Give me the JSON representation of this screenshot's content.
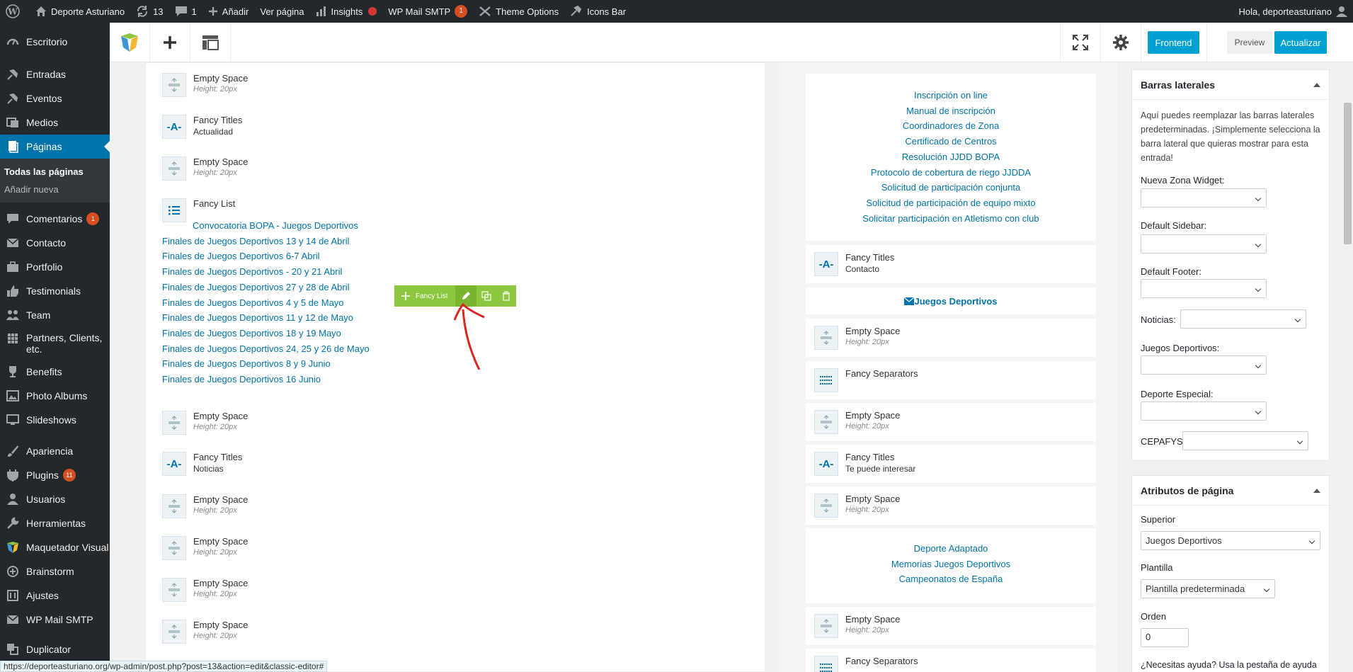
{
  "adminbar": {
    "site_name": "Deporte Asturiano",
    "updates_count": "13",
    "comments_count": "1",
    "add_new": "Añadir",
    "view_page": "Ver página",
    "insights": "Insights",
    "wp_mail_smtp": "WP Mail SMTP",
    "wp_mail_badge": "1",
    "theme_options": "Theme Options",
    "icons_bar": "Icons Bar",
    "greeting": "Hola, deporteasturiano"
  },
  "sidebar": {
    "escritorio": "Escritorio",
    "entradas": "Entradas",
    "eventos": "Eventos",
    "medios": "Medios",
    "paginas": "Páginas",
    "sub_todas": "Todas las páginas",
    "sub_nueva": "Añadir nueva",
    "comentarios": "Comentarios",
    "comentarios_badge": "1",
    "contacto": "Contacto",
    "portfolio": "Portfolio",
    "testimonials": "Testimonials",
    "team": "Team",
    "partners": "Partners, Clients, etc.",
    "benefits": "Benefits",
    "photo_albums": "Photo Albums",
    "slideshows": "Slideshows",
    "apariencia": "Apariencia",
    "plugins": "Plugins",
    "plugins_badge": "11",
    "usuarios": "Usuarios",
    "herramientas": "Herramientas",
    "maquetador": "Maquetador Visual",
    "brainstorm": "Brainstorm",
    "ajustes": "Ajustes",
    "wp_mail_smtp": "WP Mail SMTP",
    "duplicator": "Duplicator"
  },
  "vc_toolbar": {
    "frontend": "Frontend",
    "preview": "Preview",
    "update": "Actualizar"
  },
  "left_column": {
    "empty_space": "Empty Space",
    "height_20": "Height: 20px",
    "fancy_titles": "Fancy Titles",
    "fancy_list": "Fancy List",
    "title_actualidad": "Actualidad",
    "title_noticias": "Noticias",
    "list_links": [
      "Convocatoria BOPA - Juegos Deportivos",
      "Finales de Juegos Deportivos 13 y 14 de Abril",
      "Finales de Juegos Deportivos 6-7 Abril",
      "Finales de Juegos Deportivos - 20 y 21 Abril",
      "Finales de Juegos Deportivos 27 y 28 de Abril",
      "Finales de Juegos Deportivos 4 y 5 de Mayo",
      "Finales de Juegos Deportivos 11 y 12 de Mayo",
      "Finales de Juegos Deportivos 18 y 19 Mayo",
      "Finales de Juegos Deportivos 24, 25 y 26 de Mayo",
      "Finales de Juegos Deportivos 8 y 9 Junio",
      "Finales de Juegos Deportivos 16 Junio"
    ]
  },
  "fancy_list_controls": {
    "label": "Fancy List"
  },
  "right_column": {
    "links_top": [
      "Inscripción on line",
      "Manual de inscripción",
      "Coordinadores de Zona",
      "Certificado de Centros",
      "Resolución JJDD BOPA",
      "Protocolo de cobertura de riego JJDDA",
      "Solicitud de participación conjunta",
      "Solicitud de participación de equipo mixto",
      "Solicitar participación en Atletismo con club"
    ],
    "fancy_titles": "Fancy Titles",
    "title_contacto": "Contacto",
    "email_link": " Juegos Deportivos",
    "empty_space": "Empty Space",
    "height_20": "Height: 20px",
    "fancy_separators": "Fancy Separators",
    "title_interesar": "Te puede interesar",
    "links_bottom": [
      "Deporte Adaptado",
      "Memorias Juegos Deportivos",
      "Campeonatos de España"
    ]
  },
  "panel_sidebars": {
    "title": "Barras laterales",
    "description": "Aquí puedes reemplazar las barras laterales predeterminadas. ¡Simplemente selecciona la barra lateral que quieras mostrar para esta entrada!",
    "nueva_zona": "Nueva Zona Widget:",
    "default_sidebar": "Default Sidebar:",
    "default_footer": "Default Footer:",
    "noticias": "Noticias:",
    "juegos": "Juegos Deportivos:",
    "deporte_especial": "Deporte Especial:",
    "cepafys": "CEPAFYS:"
  },
  "panel_attributes": {
    "title": "Atributos de página",
    "superior_label": "Superior",
    "superior_value": "Juegos Deportivos",
    "plantilla_label": "Plantilla",
    "plantilla_value": "Plantilla predeterminada",
    "orden_label": "Orden",
    "orden_value": "0",
    "help_text": "¿Necesitas ayuda? Usa la pestaña de ayuda"
  },
  "statusbar": {
    "url": "https://deporteasturiano.org/wp-admin/post.php?post=13&action=edit&classic-editor#"
  }
}
